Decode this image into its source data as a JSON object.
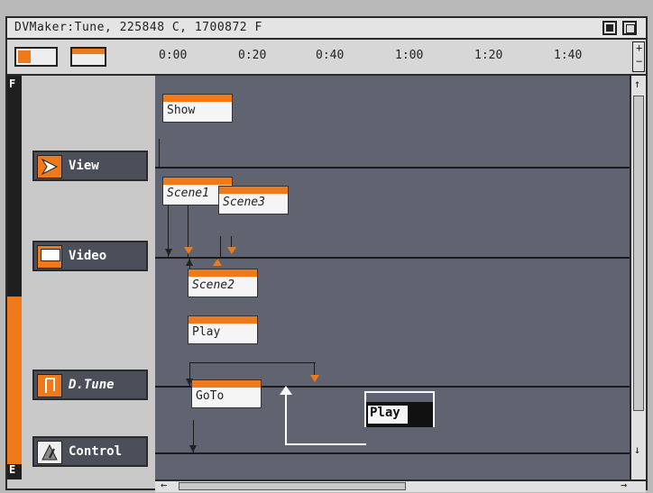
{
  "window": {
    "title": "DVMaker:Tune, 225848 C, 1700872 F"
  },
  "ruler": {
    "ticks": [
      "0:00",
      "0:20",
      "0:40",
      "1:00",
      "1:20",
      "1:40"
    ]
  },
  "sidebar": {
    "top_letter": "F",
    "bottom_letter": "E"
  },
  "tracks": [
    {
      "label": "View",
      "icon": "play-arrow-icon"
    },
    {
      "label": "Video",
      "icon": "video-frame-icon"
    },
    {
      "label": "D.Tune",
      "icon": "music-note-icon"
    },
    {
      "label": "Control",
      "icon": "metronome-icon"
    }
  ],
  "events": [
    {
      "label": "Show"
    },
    {
      "label": "Scene1"
    },
    {
      "label": "Scene3"
    },
    {
      "label": "Scene2"
    },
    {
      "label": "Play"
    },
    {
      "label": "GoTo"
    },
    {
      "label": "Play"
    }
  ],
  "colors": {
    "accent": "#f07a1a",
    "timeline_bg": "#5f6470",
    "panel": "#c9c9c9"
  }
}
